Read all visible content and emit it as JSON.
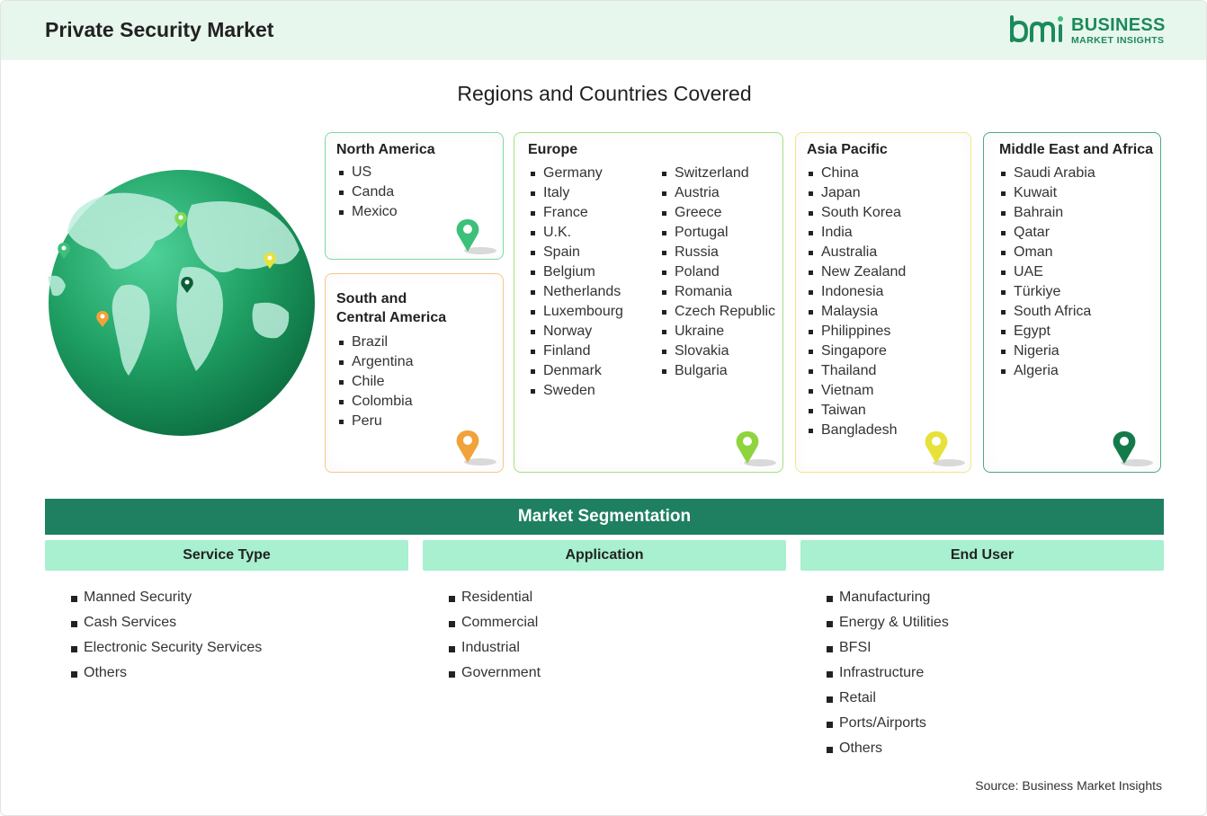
{
  "header": {
    "title": "Private Security Market",
    "logo_line1": "BUSINESS",
    "logo_line2": "MARKET INSIGHTS"
  },
  "regions_title": "Regions and Countries Covered",
  "regions": {
    "north_america": {
      "title": "North America",
      "items": [
        "US",
        "Canda",
        "Mexico"
      ],
      "pin_color": "#3cc07a"
    },
    "south_central_america": {
      "title_line1": "South and",
      "title_line2": "Central America",
      "items": [
        "Brazil",
        "Argentina",
        "Chile",
        "Colombia",
        "Peru"
      ],
      "pin_color": "#f2a23a"
    },
    "europe": {
      "title": "Europe",
      "col1": [
        "Germany",
        "Italy",
        "France",
        "U.K.",
        "Spain",
        "Belgium",
        "Netherlands",
        "Luxembourg",
        "Norway",
        "Finland",
        "Denmark",
        "Sweden"
      ],
      "col2": [
        "Switzerland",
        "Austria",
        "Greece",
        "Portugal",
        "Russia",
        "Poland",
        "Romania",
        "Czech Republic",
        "Ukraine",
        "Slovakia",
        "Bulgaria"
      ],
      "pin_color": "#8ed43e"
    },
    "asia_pacific": {
      "title": "Asia Pacific",
      "items": [
        "China",
        "Japan",
        "South Korea",
        "India",
        "Australia",
        "New Zealand",
        "Indonesia",
        "Malaysia",
        "Philippines",
        "Singapore",
        "Thailand",
        "Vietnam",
        "Taiwan",
        "Bangladesh"
      ],
      "pin_color": "#e6e23a"
    },
    "middle_east_africa": {
      "title": "Middle East and Africa",
      "items": [
        "Saudi Arabia",
        "Kuwait",
        "Bahrain",
        "Qatar",
        "Oman",
        "UAE",
        "Türkiye",
        "South Africa",
        "Egypt",
        "Nigeria",
        "Algeria"
      ],
      "pin_color": "#157a4a"
    }
  },
  "segmentation": {
    "title": "Market Segmentation",
    "columns": [
      {
        "title": "Service Type",
        "items": [
          "Manned Security",
          "Cash Services",
          "Electronic Security Services",
          "Others"
        ]
      },
      {
        "title": "Application",
        "items": [
          "Residential",
          "Commercial",
          "Industrial",
          "Government"
        ]
      },
      {
        "title": "End User",
        "items": [
          "Manufacturing",
          "Energy & Utilities",
          "BFSI",
          "Infrastructure",
          "Retail",
          "Ports/Airports",
          "Others"
        ]
      }
    ]
  },
  "source": "Source: Business Market Insights",
  "colors": {
    "header_bg": "#e8f7ee",
    "brand_green": "#1c8a5a",
    "segment_header": "#1e8060",
    "segment_col_head": "#a8f0cf"
  }
}
